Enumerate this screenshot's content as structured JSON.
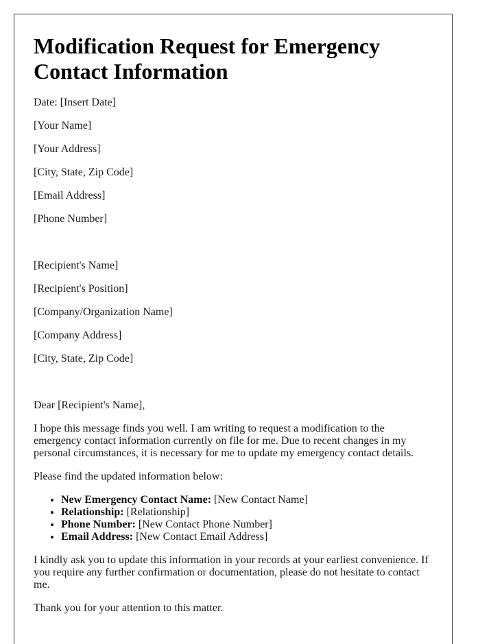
{
  "document": {
    "title": "Modification Request for Emergency Contact Information",
    "date_line": "Date: [Insert Date]",
    "sender": [
      "[Your Name]",
      "[Your Address]",
      "[City, State, Zip Code]",
      "[Email Address]",
      "[Phone Number]"
    ],
    "recipient": [
      "[Recipient's Name]",
      "[Recipient's Position]",
      "[Company/Organization Name]",
      "[Company Address]",
      "[City, State, Zip Code]"
    ],
    "salutation": "Dear [Recipient's Name],",
    "intro_paragraph": "I hope this message finds you well. I am writing to request a modification to the emergency contact information currently on file for me. Due to recent changes in my personal circumstances, it is necessary for me to update my emergency contact details.",
    "list_intro": "Please find the updated information below:",
    "details": [
      {
        "label": "New Emergency Contact Name:",
        "value": " [New Contact Name]"
      },
      {
        "label": "Relationship:",
        "value": " [Relationship]"
      },
      {
        "label": "Phone Number:",
        "value": " [New Contact Phone Number]"
      },
      {
        "label": "Email Address:",
        "value": " [New Contact Email Address]"
      }
    ],
    "request_paragraph": "I kindly ask you to update this information in your records at your earliest convenience. If you require any further confirmation or documentation, please do not hesitate to contact me.",
    "closing_paragraph": "Thank you for your attention to this matter."
  }
}
